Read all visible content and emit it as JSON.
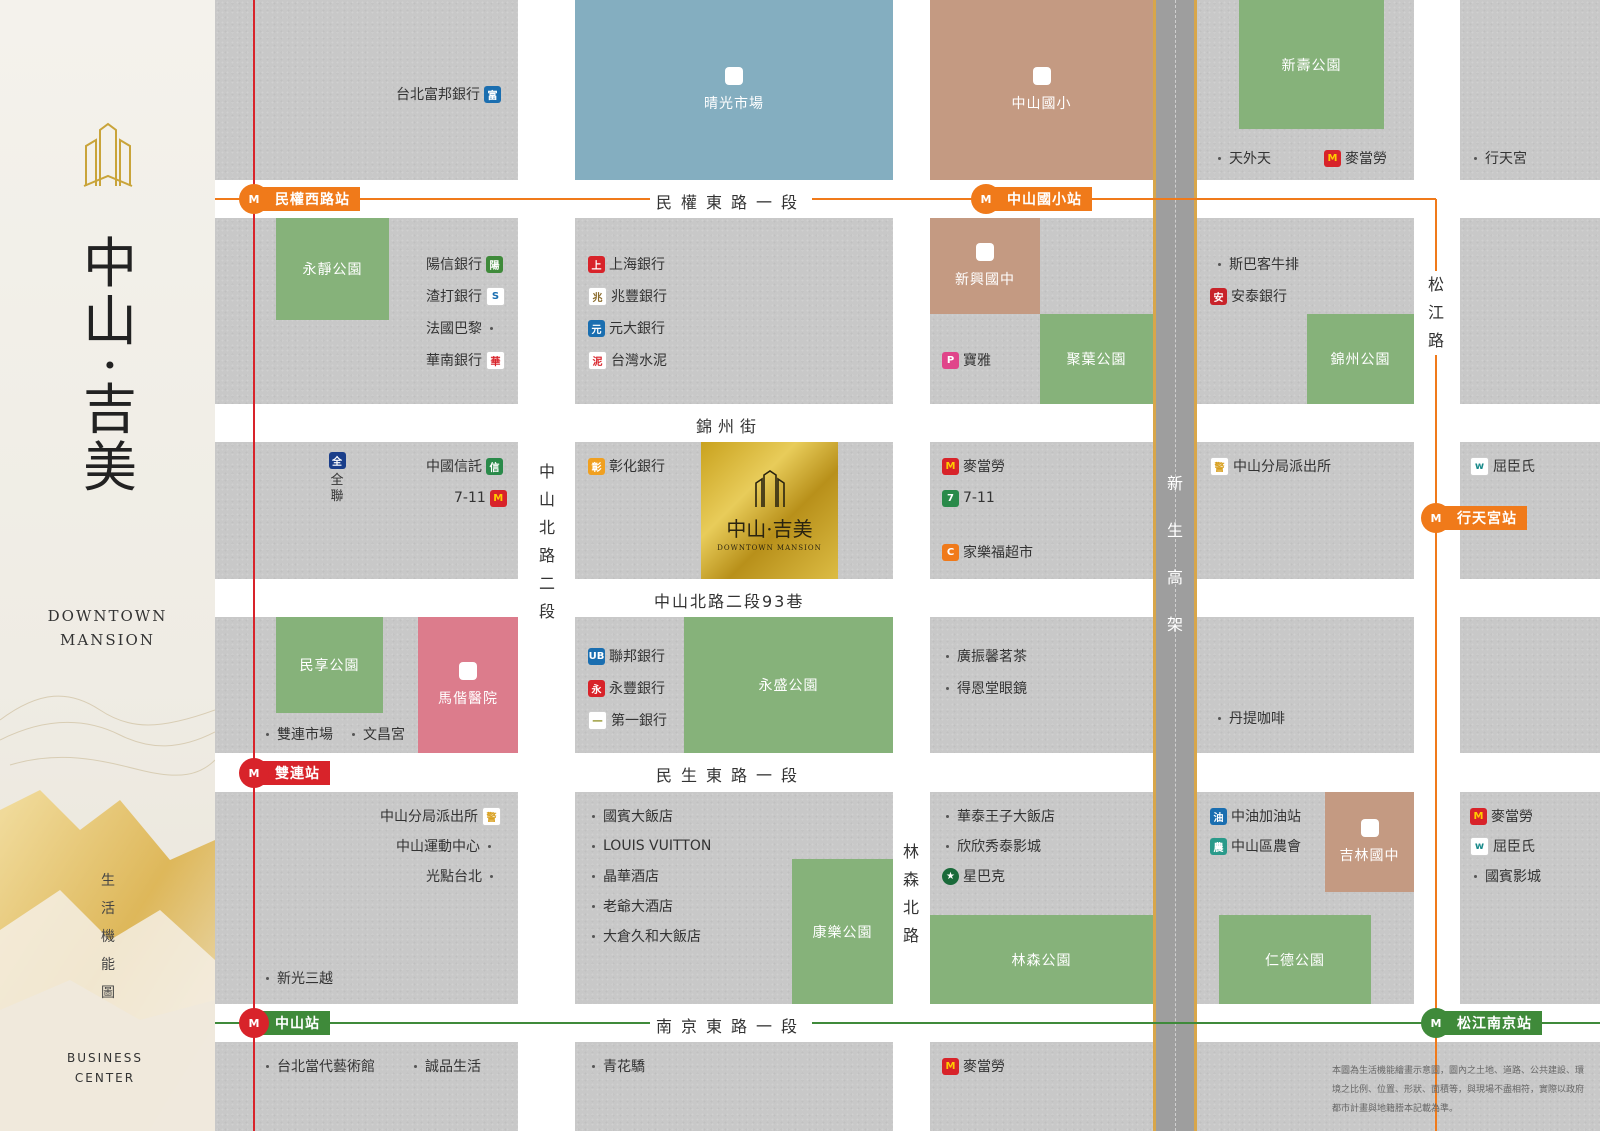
{
  "sidebar": {
    "title_chars": [
      "中",
      "山",
      "·",
      "吉",
      "美"
    ],
    "english_line1": "DOWNTOWN",
    "english_line2": "MANSION",
    "subtitle_chars": [
      "生",
      "活",
      "機",
      "能",
      "圖"
    ],
    "business_line1": "BUSINESS",
    "business_line2": "CENTER"
  },
  "site": {
    "name": "中山·吉美",
    "english": "DOWNTOWN MANSION"
  },
  "roads": {
    "minquan": "民權東路一段",
    "jinzhou": "錦州街",
    "lane93": "中山北路二段93巷",
    "minsheng": "民生東路一段",
    "nanjing": "南京東路一段",
    "zhongshan_n": [
      "中",
      "山",
      "北",
      "路",
      "二",
      "段"
    ],
    "linsen_n": [
      "林",
      "森",
      "北",
      "路"
    ],
    "songjiang": [
      "松",
      "江",
      "路"
    ],
    "xinsheng": [
      "新",
      "生",
      "高",
      "架"
    ]
  },
  "stations": [
    {
      "id": "minquan-w",
      "label": "民權西路站",
      "color": "#f07a1a"
    },
    {
      "id": "zhongshan-elem",
      "label": "中山國小站",
      "color": "#f07a1a"
    },
    {
      "id": "xingtian",
      "label": "行天宮站",
      "color": "#f07a1a"
    },
    {
      "id": "shuanglian",
      "label": "雙連站",
      "color": "#d8232a"
    },
    {
      "id": "zhongshan",
      "label": "中山站",
      "color": "#d8232a"
    },
    {
      "id": "songjiang-nanjing",
      "label": "松江南京站",
      "color": "#3f8a3a"
    }
  ],
  "areas": {
    "market": "晴光市場",
    "zhongshan_elem": "中山國小",
    "xinshou_park": "新壽公園",
    "yongjing_park": "永靜公園",
    "xinxing_jr": "新興國中",
    "juye_park": "聚葉公園",
    "jinzhou_park": "錦州公園",
    "minxiang_park": "民享公園",
    "mackay": "馬偕醫院",
    "yongsheng_park": "永盛公園",
    "kangle_park": "康樂公園",
    "linsen_park": "林森公園",
    "jilin_jr": "吉林國中",
    "rende_park": "仁德公園"
  },
  "poi": {
    "fubon": "台北富邦銀行",
    "tianwaitian": "天外天",
    "mcd": "麥當勞",
    "xingtiangong": "行天宮",
    "sunny": "陽信銀行",
    "sc": "渣打銀行",
    "paris": "法國巴黎",
    "huanan": "華南銀行",
    "shanghai": "上海銀行",
    "megabank": "兆豐銀行",
    "yuanta": "元大銀行",
    "tcc": "台灣水泥",
    "poya": "寶雅",
    "steakhouse": "斯巴客牛排",
    "entie": "安泰銀行",
    "ctbc": "中國信託",
    "seven": "7-11",
    "pxmart": "全聯",
    "changhwa": "彰化銀行",
    "carrefour": "家樂福超市",
    "police": "中山分局派出所",
    "watsons": "屈臣氏",
    "ubot": "聯邦銀行",
    "sinopac": "永豐銀行",
    "firstbank": "第一銀行",
    "tea": "廣振馨茗茶",
    "optical": "得恩堂眼鏡",
    "dante": "丹提咖啡",
    "shuanglian_market": "雙連市場",
    "wenchang": "文昌宮",
    "sports": "中山運動中心",
    "spot": "光點台北",
    "ambassador": "國賓大飯店",
    "lv": "LOUIS VUITTON",
    "regent": "晶華酒店",
    "landis": "老爺大酒店",
    "okura": "大倉久和大飯店",
    "palais": "華泰王子大飯店",
    "ambassador_cinema": "欣欣秀泰影城",
    "starbucks": "星巴克",
    "cpc": "中油加油站",
    "farmers": "中山區農會",
    "ambassador_theater": "國賓影城",
    "skm": "新光三越",
    "moca": "台北當代藝術館",
    "eslite": "誠品生活",
    "qinghua": "青花驕"
  },
  "disclaimer": "本圖為生活機能繪畫示意圖，圖內之土地、道路、公共建設、環境之比例、位置、形狀、面積等，與現場不盡相符，實際以政府都市計畫與地籍謄本記載為準。"
}
